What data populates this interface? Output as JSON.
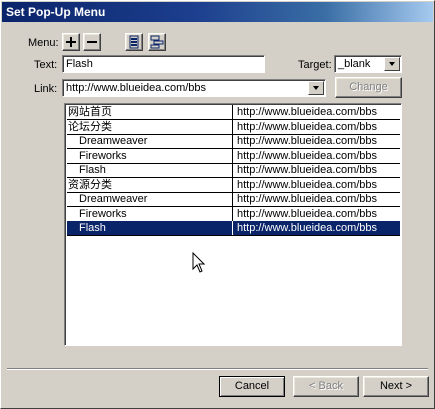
{
  "window": {
    "title": "Set Pop-Up Menu"
  },
  "toolbar": {
    "menu_label": "Menu:",
    "add_symbol": "+",
    "remove_symbol": "−"
  },
  "form": {
    "text_label": "Text:",
    "text_value": "Flash",
    "target_label": "Target:",
    "target_value": "_blank",
    "link_label": "Link:",
    "link_value": "http://www.blueidea.com/bbs",
    "change_label": "Change"
  },
  "menu_items": [
    {
      "name": "网站首页",
      "link": "http://www.blueidea.com/bbs",
      "indent": false,
      "selected": false
    },
    {
      "name": "论坛分类",
      "link": "http://www.blueidea.com/bbs",
      "indent": false,
      "selected": false
    },
    {
      "name": "Dreamweaver",
      "link": "http://www.blueidea.com/bbs",
      "indent": true,
      "selected": false
    },
    {
      "name": "Fireworks",
      "link": "http://www.blueidea.com/bbs",
      "indent": true,
      "selected": false
    },
    {
      "name": "Flash",
      "link": "http://www.blueidea.com/bbs",
      "indent": true,
      "selected": false
    },
    {
      "name": "资源分类",
      "link": "http://www.blueidea.com/bbs",
      "indent": false,
      "selected": false
    },
    {
      "name": "Dreamweaver",
      "link": "http://www.blueidea.com/bbs",
      "indent": true,
      "selected": false
    },
    {
      "name": "Fireworks",
      "link": "http://www.blueidea.com/bbs",
      "indent": true,
      "selected": false
    },
    {
      "name": "Flash",
      "link": "http://www.blueidea.com/bbs",
      "indent": true,
      "selected": true
    }
  ],
  "footer": {
    "cancel_label": "Cancel",
    "back_label": "< Back",
    "next_label": "Next >"
  },
  "icons": {
    "add": "plus-icon",
    "remove": "minus-icon",
    "outdent": "outdent-icon",
    "indent": "indent-icon",
    "dropdown": "chevron-down-icon",
    "cursor": "mouse-pointer-icon"
  },
  "colors": {
    "title_start": "#0a246a",
    "title_end": "#a6caf0",
    "selection": "#0a246a",
    "face": "#d4d0c8"
  }
}
